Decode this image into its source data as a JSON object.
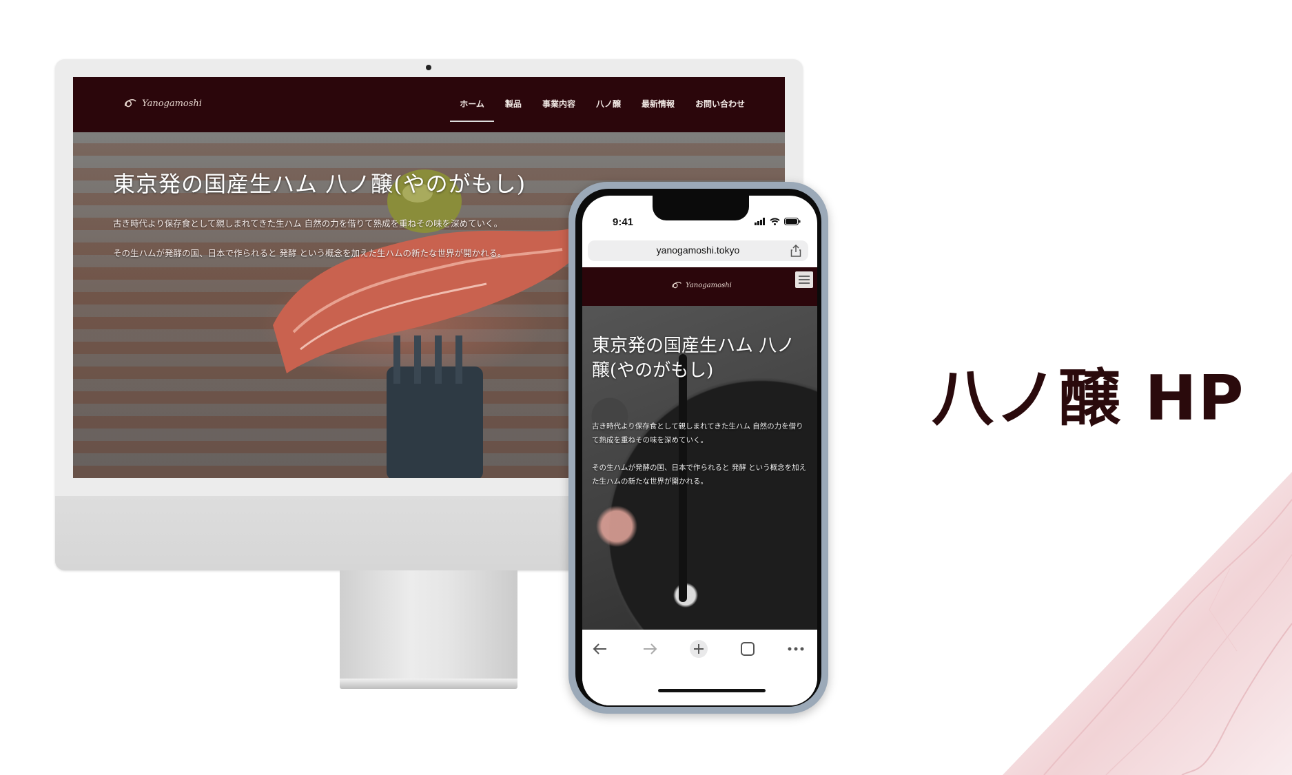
{
  "desktop": {
    "logo_text": "Yanogamoshi",
    "nav": [
      "ホーム",
      "製品",
      "事業内容",
      "八ノ醸",
      "最新情報",
      "お問い合わせ"
    ],
    "hero_title": "東京発の国産生ハム 八ノ醸(やのがもし)",
    "hero_p1": "古き時代より保存食として親しまれてきた生ハム 自然の力を借りて熟成を重ねその味を深めていく。",
    "hero_p2": "その生ハムが発酵の国、日本で作られると 発酵 という概念を加えた生ハムの新たな世界が開かれる。"
  },
  "mobile": {
    "time": "9:41",
    "url": "yanogamoshi.tokyo",
    "logo_text": "Yanogamoshi",
    "hero_title": "東京発の国産生ハム 八ノ醸(やのがもし)",
    "hero_p1": "古き時代より保存食として親しまれてきた生ハム 自然の力を借りて熟成を重ねその味を深めていく。",
    "hero_p2": "その生ハムが発酵の国、日本で作られると 発酵 という概念を加えた生ハムの新たな世界が開かれる。",
    "toolbar_icons": [
      "back-arrow-icon",
      "forward-arrow-icon",
      "new-tab-plus-icon",
      "tabs-square-icon",
      "more-dots-icon"
    ]
  },
  "heading": "八ノ醸 HP",
  "colors": {
    "brand_dark": "#2b060b",
    "heading": "#2a0a0c"
  }
}
